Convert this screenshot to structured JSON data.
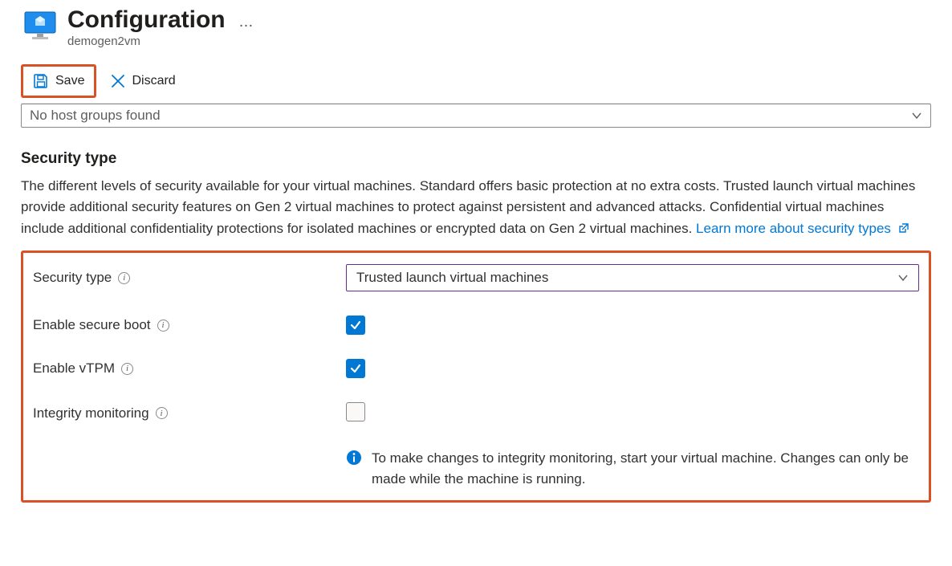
{
  "header": {
    "title": "Configuration",
    "subtitle": "demogen2vm",
    "more_label": "..."
  },
  "toolbar": {
    "save_label": "Save",
    "discard_label": "Discard"
  },
  "hostgroup_dropdown": {
    "text": "No host groups found"
  },
  "security": {
    "heading": "Security type",
    "description": "The different levels of security available for your virtual machines. Standard offers basic protection at no extra costs. Trusted launch virtual machines provide additional security features on Gen 2 virtual machines to protect against persistent and advanced attacks. Confidential virtual machines include additional confidentiality protections for isolated machines or encrypted data on Gen 2 virtual machines. ",
    "learn_more": "Learn more about security types",
    "fields": {
      "type_label": "Security type",
      "type_value": "Trusted launch virtual machines",
      "secureboot_label": "Enable secure boot",
      "secureboot_checked": true,
      "vtpm_label": "Enable vTPM",
      "vtpm_checked": true,
      "integrity_label": "Integrity monitoring",
      "integrity_checked": false
    },
    "note": "To make changes to integrity monitoring, start your virtual machine. Changes can only be made while the machine is running."
  }
}
